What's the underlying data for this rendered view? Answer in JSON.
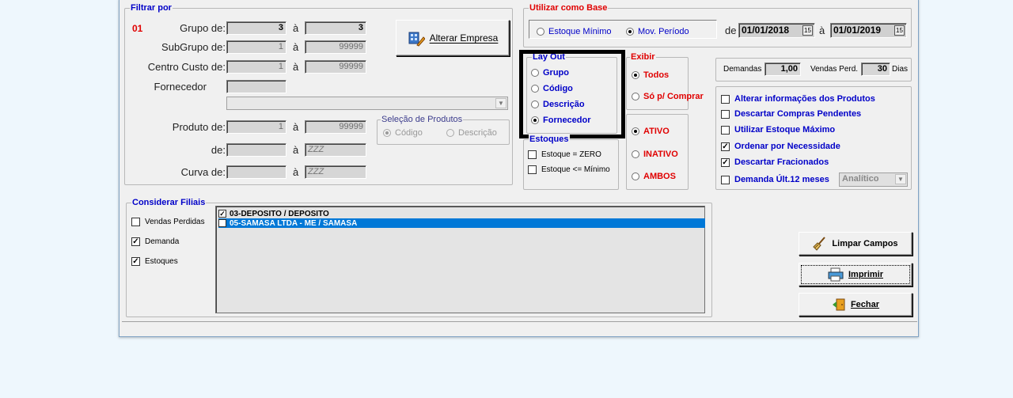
{
  "filtrar": {
    "legend": "Filtrar por",
    "code": "01",
    "grupo_label": "Grupo de:",
    "grupo_from": "3",
    "grupo_to": "3",
    "subgrupo_label": "SubGrupo de:",
    "subgrupo_from": "1",
    "subgrupo_to": "99999",
    "centro_label": "Centro Custo de:",
    "centro_from": "1",
    "centro_to": "99999",
    "fornecedor_label": "Fornecedor",
    "produto_label": "Produto de:",
    "produto_from": "1",
    "produto_to": "99999",
    "de_label": "de:",
    "de_to": "ZZZ",
    "curva_label": "Curva de:",
    "curva_to": "ZZZ",
    "a": "à",
    "alterar_empresa": "Alterar Empresa",
    "selecao_legend": "Seleção de Produtos",
    "selecao_codigo": "Código",
    "selecao_descricao": "Descrição"
  },
  "base": {
    "legend": "Utilizar como Base",
    "estoque_minimo": "Estoque Mínimo",
    "mov_periodo": "Mov. Período",
    "de": "de",
    "a": "à",
    "date_from": "01/01/2018",
    "date_to": "01/01/2019"
  },
  "layout": {
    "legend": "Lay Out",
    "options": [
      "Grupo",
      "Código",
      "Descrição",
      "Fornecedor"
    ],
    "selected": "Fornecedor"
  },
  "exibir": {
    "legend": "Exibir",
    "todos": "Todos",
    "so_comprar": "Só p/ Comprar"
  },
  "status": {
    "ativo": "ATIVO",
    "inativo": "INATIVO",
    "ambos": "AMBOS"
  },
  "estoques": {
    "legend": "Estoques",
    "zero": "Estoque = ZERO",
    "minimo": "Estoque <= Mínimo"
  },
  "demandas": {
    "label": "Demandas",
    "value": "1,00",
    "vendas_label": "Vendas Perd.",
    "vendas_value": "30",
    "dias": "Dias"
  },
  "options": {
    "alterar_info": "Alterar informações dos Produtos",
    "descartar_pendentes": "Descartar Compras Pendentes",
    "estoque_maximo": "Utilizar Estoque Máximo",
    "ordenar": "Ordenar por Necessidade",
    "fracionados": "Descartar Fracionados",
    "demanda_12": "Demanda Últ.12 meses",
    "analitico": "Analítico"
  },
  "filiais": {
    "legend": "Considerar Filiais",
    "vendas_perdidas": "Vendas Perdidas",
    "demanda": "Demanda",
    "estoques": "Estoques",
    "items": [
      "03-DEPOSITO / DEPOSITO",
      "05-SAMASA LTDA - ME / SAMASA"
    ]
  },
  "buttons": {
    "limpar": "Limpar Campos",
    "imprimir": "Imprimir",
    "fechar": "Fechar"
  }
}
